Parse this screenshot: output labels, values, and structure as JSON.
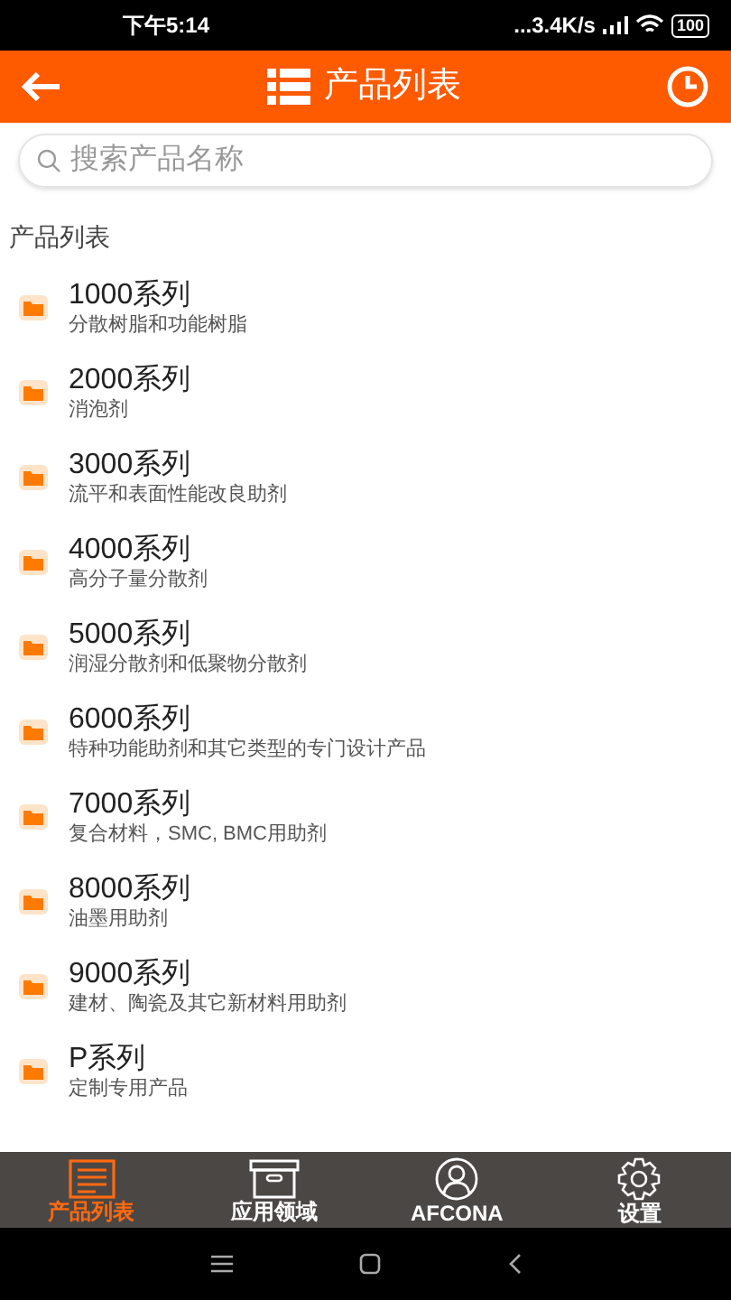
{
  "status_bar": {
    "time": "下午5:14",
    "network_speed": "...3.4K/s",
    "battery": "100"
  },
  "header": {
    "title": "产品列表"
  },
  "search": {
    "placeholder": "搜索产品名称"
  },
  "section_title": "产品列表",
  "items": [
    {
      "title": "1000系列",
      "subtitle": "分散树脂和功能树脂"
    },
    {
      "title": "2000系列",
      "subtitle": "消泡剂"
    },
    {
      "title": "3000系列",
      "subtitle": "流平和表面性能改良助剂"
    },
    {
      "title": "4000系列",
      "subtitle": "高分子量分散剂"
    },
    {
      "title": "5000系列",
      "subtitle": "润湿分散剂和低聚物分散剂"
    },
    {
      "title": "6000系列",
      "subtitle": "特种功能助剂和其它类型的专门设计产品"
    },
    {
      "title": "7000系列",
      "subtitle": "复合材料，SMC, BMC用助剂"
    },
    {
      "title": "8000系列",
      "subtitle": "油墨用助剂"
    },
    {
      "title": "9000系列",
      "subtitle": "建材、陶瓷及其它新材料用助剂"
    },
    {
      "title": "P系列",
      "subtitle": "定制专用产品"
    }
  ],
  "tabs": [
    {
      "kind": "list",
      "label": "产品列表",
      "selected": true
    },
    {
      "kind": "box",
      "label": "应用领域",
      "selected": false
    },
    {
      "kind": "person",
      "label": "AFCONA",
      "selected": false
    },
    {
      "kind": "gear",
      "label": "设置",
      "selected": false
    }
  ]
}
